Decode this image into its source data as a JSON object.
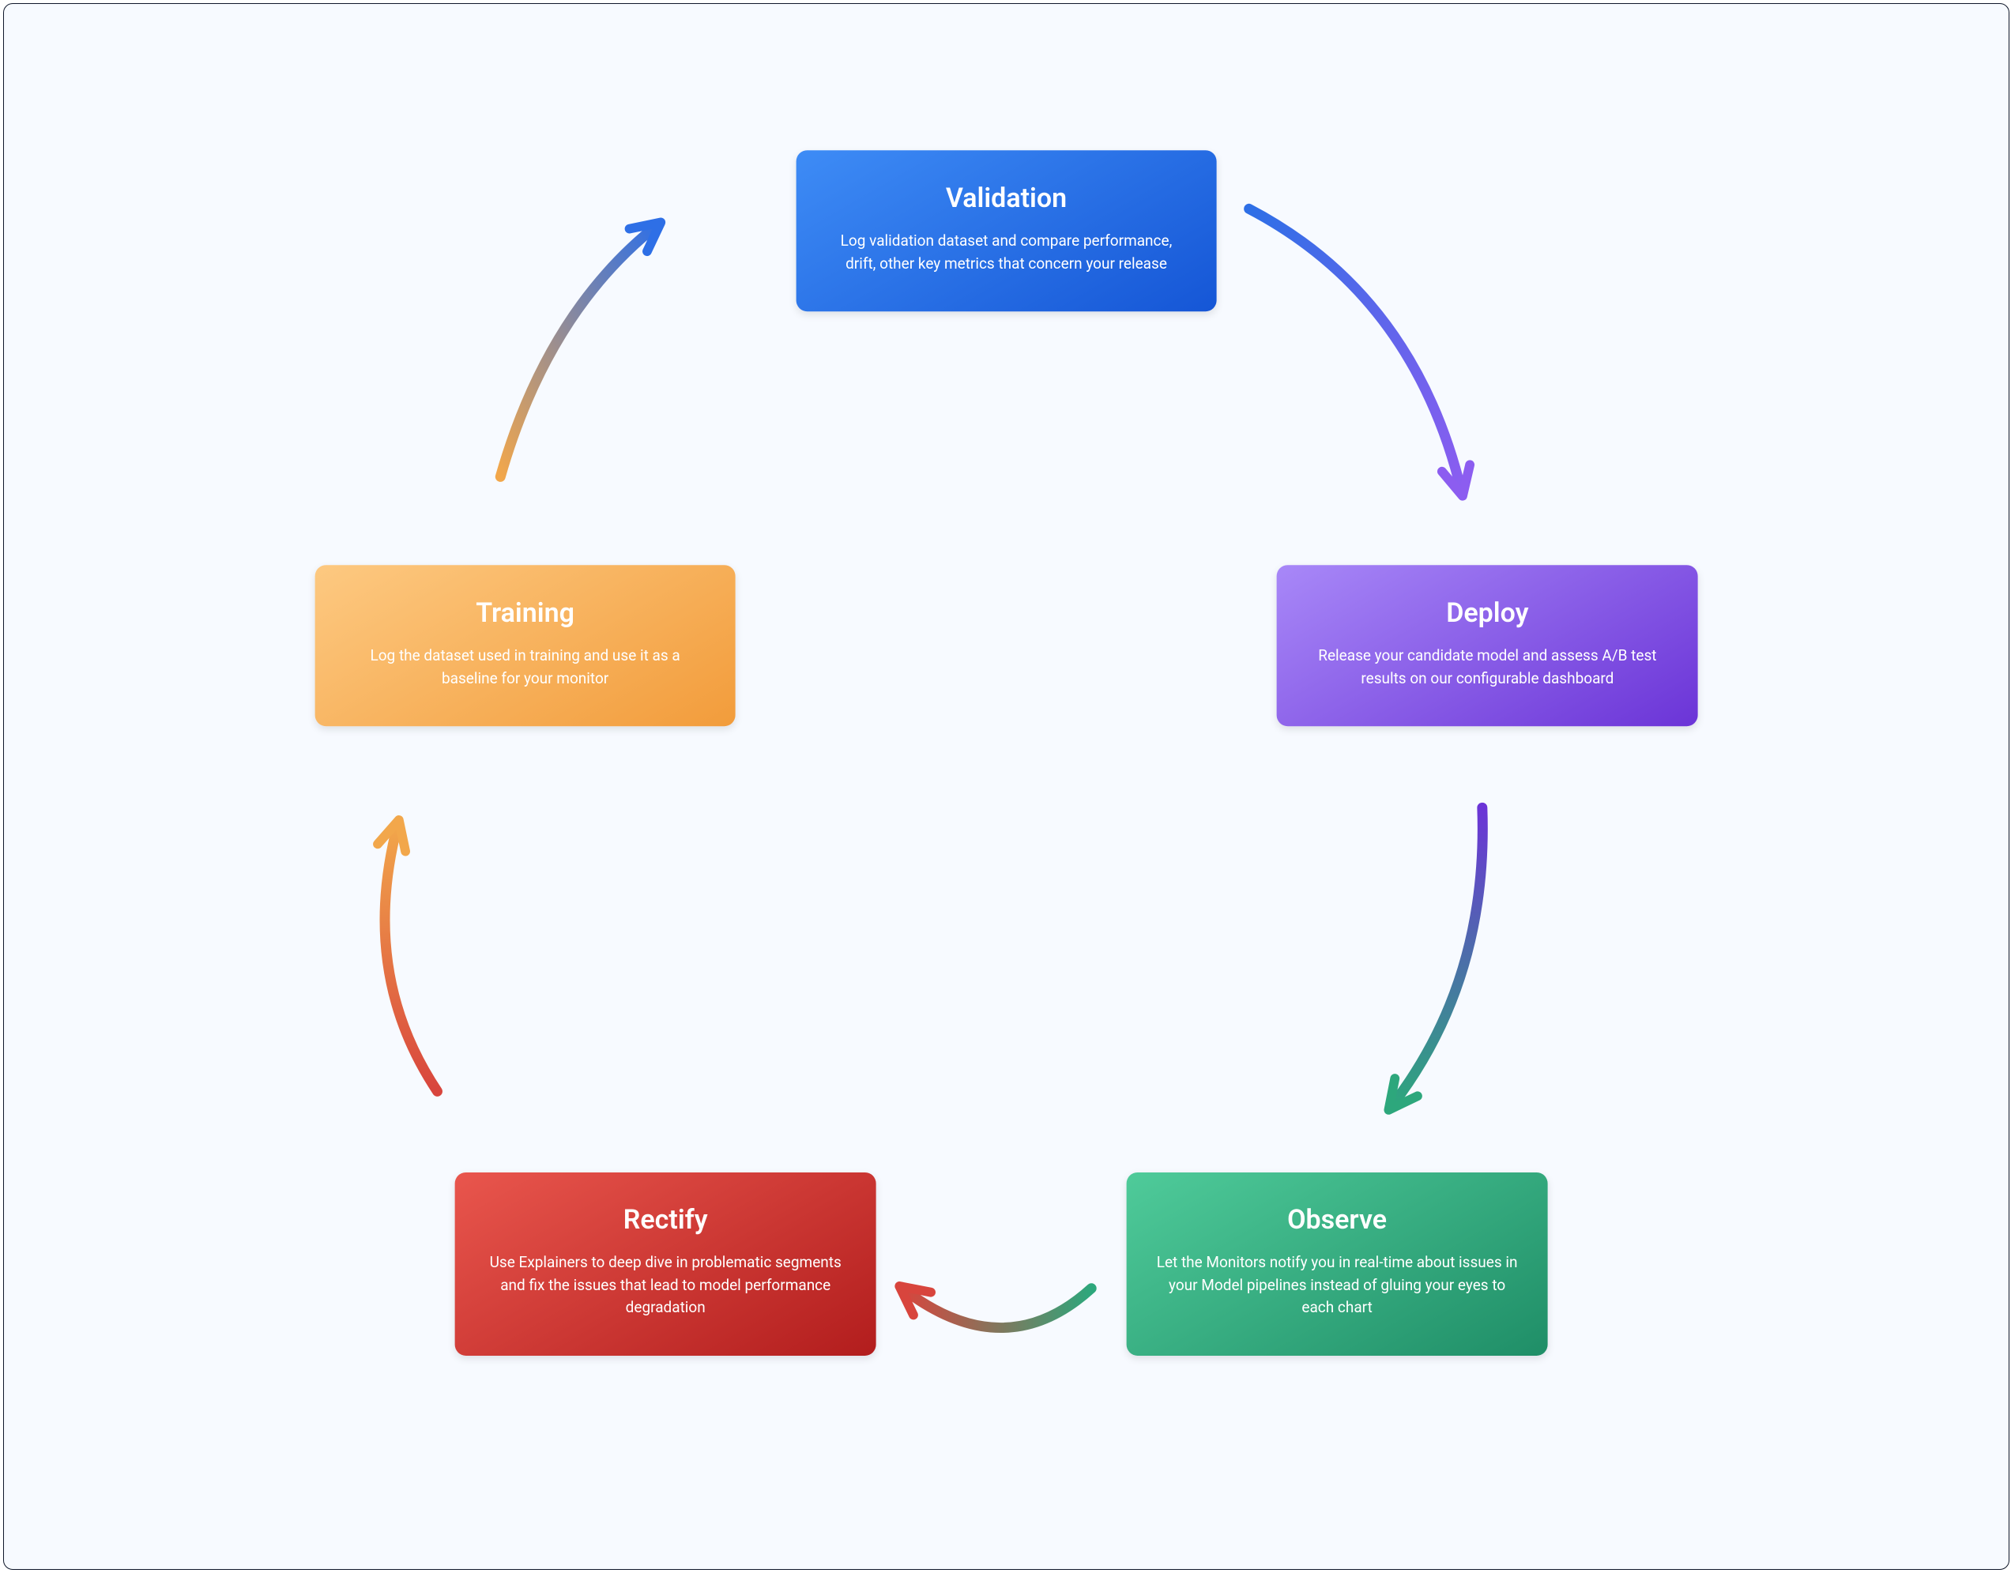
{
  "diagram": {
    "type": "cycle",
    "background": "#F7FAFF",
    "nodes": {
      "validation": {
        "title": "Validation",
        "desc": "Log validation dataset and compare performance, drift, other key metrics that concern your release",
        "gradient_from": "#3E8CF6",
        "gradient_to": "#1556D6"
      },
      "deploy": {
        "title": "Deploy",
        "desc": "Release your candidate model and assess A/B test results on our configurable dashboard",
        "gradient_from": "#A888F8",
        "gradient_to": "#6B34D7"
      },
      "observe": {
        "title": "Observe",
        "desc": "Let the Monitors notify you in real-time about issues in your Model pipelines instead of gluing your eyes to each chart",
        "gradient_from": "#4FCB9A",
        "gradient_to": "#1F8E67"
      },
      "rectify": {
        "title": "Rectify",
        "desc": "Use Explainers to deep dive in problematic segments and fix the issues that lead to model performance degradation",
        "gradient_from": "#E9564D",
        "gradient_to": "#B21D1D"
      },
      "training": {
        "title": "Training",
        "desc": "Log the dataset used in training and use it as a baseline for your monitor",
        "gradient_from": "#FDC981",
        "gradient_to": "#F29C3B"
      }
    },
    "arrows": {
      "validation_to_deploy": {
        "from_color": "#2E6FE6",
        "to_color": "#8C5DF0"
      },
      "deploy_to_observe": {
        "from_color": "#6B34D7",
        "to_color": "#2DA77C"
      },
      "observe_to_rectify": {
        "from_color": "#2DA77C",
        "to_color": "#D8453D"
      },
      "rectify_to_training": {
        "from_color": "#D8453D",
        "to_color": "#F2A74B"
      },
      "training_to_validation": {
        "from_color": "#F2A74B",
        "to_color": "#2E6FE6"
      }
    }
  }
}
